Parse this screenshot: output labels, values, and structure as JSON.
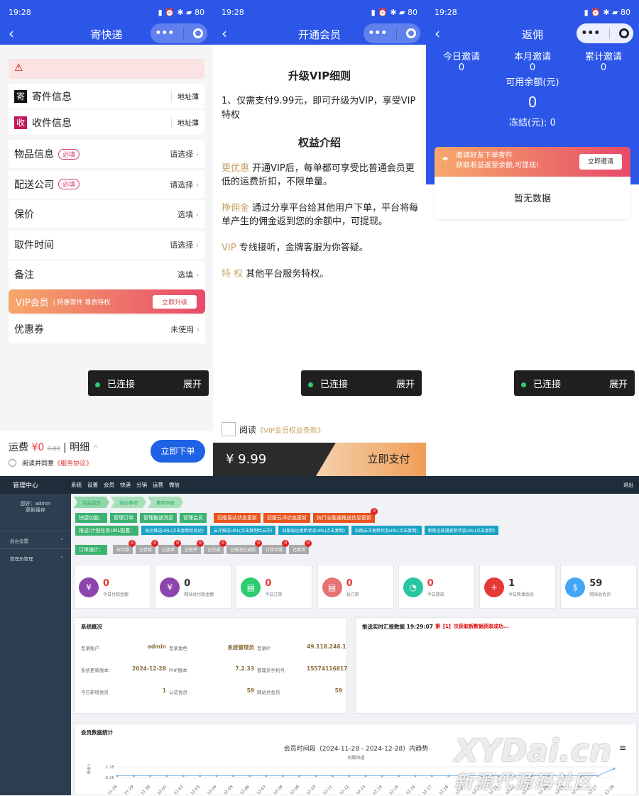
{
  "phone1": {
    "time": "19:28",
    "title": "寄快递",
    "sender": "寄件信息",
    "sender_icon": "寄",
    "receiver": "收件信息",
    "receiver_icon": "收",
    "address_book": "地址薄",
    "rows": [
      {
        "label": "物品信息",
        "badge": "必填",
        "value": "请选择"
      },
      {
        "label": "配送公司",
        "badge": "必填",
        "value": "请选择"
      },
      {
        "label": "保价",
        "badge": "",
        "value": "选填"
      },
      {
        "label": "取件时间",
        "badge": "",
        "value": "请选择"
      },
      {
        "label": "备注",
        "badge": "",
        "value": "选填"
      }
    ],
    "vip_title": "VIP会员",
    "vip_sub": "特惠寄件 尊贵特权",
    "vip_btn": "立即升级",
    "coupon_label": "优惠券",
    "coupon_value": "未使用",
    "connected": "已连接",
    "expand": "展开",
    "fee_label": "运费",
    "fee_value": "¥0",
    "fee_old": "0.00",
    "detail": "明细",
    "order_btn": "立即下单",
    "agree": "阅读并同意",
    "agree_link": "《服务协议》"
  },
  "phone2": {
    "time": "19:28",
    "title": "开通会员",
    "h1": "升级VIP细则",
    "p1": "1、仅需支付9.99元，即可升级为VIP，享受VIP特权",
    "h2": "权益介绍",
    "items": [
      {
        "key": "更优惠",
        "text": "开通VIP后，每单都可享受比普通会员更低的运费折扣，不限单量。"
      },
      {
        "key": "挣佣金",
        "text": "通过分享平台给其他用户下单，平台将每单产生的佣金返到您的余额中，可提现。"
      },
      {
        "key": "VIP",
        "text": "专线接听，金牌客服为你答疑。"
      },
      {
        "key": "特 权",
        "text": "其他平台服务特权。"
      }
    ],
    "connected": "已连接",
    "expand": "展开",
    "read": "阅读",
    "read_link": "《VIP会员权益条款》",
    "price": "¥ 9.99",
    "pay_btn": "立即支付"
  },
  "phone3": {
    "time": "19:28",
    "title": "返佣",
    "stats": [
      {
        "label": "今日邀请",
        "value": "0"
      },
      {
        "label": "本月邀请",
        "value": "0"
      },
      {
        "label": "累计邀请",
        "value": "0"
      }
    ],
    "balance_label": "可用余额(元)",
    "balance": "0",
    "frozen": "冻结(元): 0",
    "invite_title": "邀请好友下单寄件",
    "invite_sub": "获取收益返至余额,可提现!",
    "invite_btn": "立即邀请",
    "empty": "暂无数据",
    "connected": "已连接",
    "expand": "展开"
  },
  "admin": {
    "brand": "管理中心",
    "menu": [
      "系统",
      "设置",
      "会员",
      "快递",
      "分销",
      "运营",
      "微信"
    ],
    "logout": "退出",
    "hello": "您好：admin",
    "clear_cache": "更新缓存",
    "side": [
      "后台设置",
      "管理员管理"
    ],
    "crumbs": [
      "后台首页",
      "待办事项",
      "事项列表"
    ],
    "quick_label": "快捷功能：",
    "quick": [
      "管理订单",
      "管理推送消息",
      "管理会员"
    ],
    "orange_btns": [
      "旧版易达状态更新",
      "旧版云洋状态更新",
      "执行全能通推送信息更新"
    ],
    "push_label": "推送/计划任务URL配置：",
    "push_btns": [
      "易达推送URL(点击复制给易达)",
      "云洋推送URL(点击复制给云洋)",
      "旧版易达更新状态URL(点击复制)",
      "旧版云洋更新状态URL(点击复制)",
      "新版全能通更新状态URL(点击复制)"
    ],
    "order_label": "订单统计：",
    "order_tags": [
      "未付款",
      "已付款",
      "已接单",
      "已取件",
      "已完成",
      "已取消已退款",
      "订单异常",
      "已取消"
    ],
    "order_counts": [
      "0",
      "0",
      "0",
      "0",
      "0",
      "0",
      "0",
      "0"
    ],
    "cards": [
      {
        "value": "0",
        "label": "今日付款金额",
        "color": "#8e44ad",
        "icon": "¥"
      },
      {
        "value": "0",
        "label": "网站总付款金额",
        "color": "#8e44ad",
        "icon": "¥"
      },
      {
        "value": "0",
        "label": "今日订单",
        "color": "#2ecc71",
        "icon": "▤"
      },
      {
        "value": "0",
        "label": "总订单",
        "color": "#e57373",
        "icon": "▤"
      },
      {
        "value": "0",
        "label": "今日提现",
        "color": "#26c6a0",
        "icon": "◔"
      },
      {
        "value": "1",
        "label": "今日新增会员",
        "color": "#e53935",
        "icon": "+"
      },
      {
        "value": "59",
        "label": "网站总会员",
        "color": "#42a5f5",
        "icon": "$"
      }
    ],
    "overview_title": "系统概况",
    "overview": [
      {
        "k": "登录账户",
        "v": "admin"
      },
      {
        "k": "登录角色",
        "v": "系统管理员"
      },
      {
        "k": "登录IP",
        "v": "49.118.246.1"
      },
      {
        "k": "系统更新版本",
        "v": "2024-12-28"
      },
      {
        "k": "PHP版本",
        "v": "7.2.33"
      },
      {
        "k": "管理员手机号",
        "v": "15574116817"
      },
      {
        "k": "今日新增会员",
        "v": "1"
      },
      {
        "k": "认证会员",
        "v": "59"
      },
      {
        "k": "网站总会员",
        "v": "59"
      }
    ],
    "push_title": "推送实时汇报数据 19:29:07",
    "push_msg": "第【1】次获取新数据获取成功..."
  },
  "chart_data": {
    "type": "line",
    "panel_title": "会员数据统计",
    "title": "会员时间段（2024-11-28 - 2024-12-28）内趋势",
    "subtitle": "风歌快递",
    "ylabel": "新增人",
    "y_ticks": [
      "1.25",
      "-0.25"
    ],
    "x": [
      "11-28",
      "11-29",
      "11-30",
      "12-01",
      "12-02",
      "12-03",
      "12-04",
      "12-05",
      "12-06",
      "12-07",
      "12-08",
      "12-09",
      "12-10",
      "12-11",
      "12-12",
      "12-13",
      "12-14",
      "12-15",
      "12-16",
      "12-17",
      "12-18",
      "12-19",
      "12-20",
      "12-21",
      "12-22",
      "12-23",
      "12-24",
      "12-25",
      "12-26",
      "12-27",
      "12-28"
    ],
    "values": [
      0,
      0,
      0,
      0,
      0,
      0,
      0,
      0,
      0,
      0,
      0,
      0,
      0,
      0,
      0,
      0,
      0,
      0,
      0,
      0,
      0,
      0,
      0,
      0,
      0,
      0,
      0,
      0,
      0,
      0,
      1
    ],
    "ylim": [
      -0.25,
      1.25
    ],
    "color": "#7cb5ec"
  },
  "watermark": {
    "line1": "XYDai.cn",
    "line2": "新源代源码社区"
  }
}
